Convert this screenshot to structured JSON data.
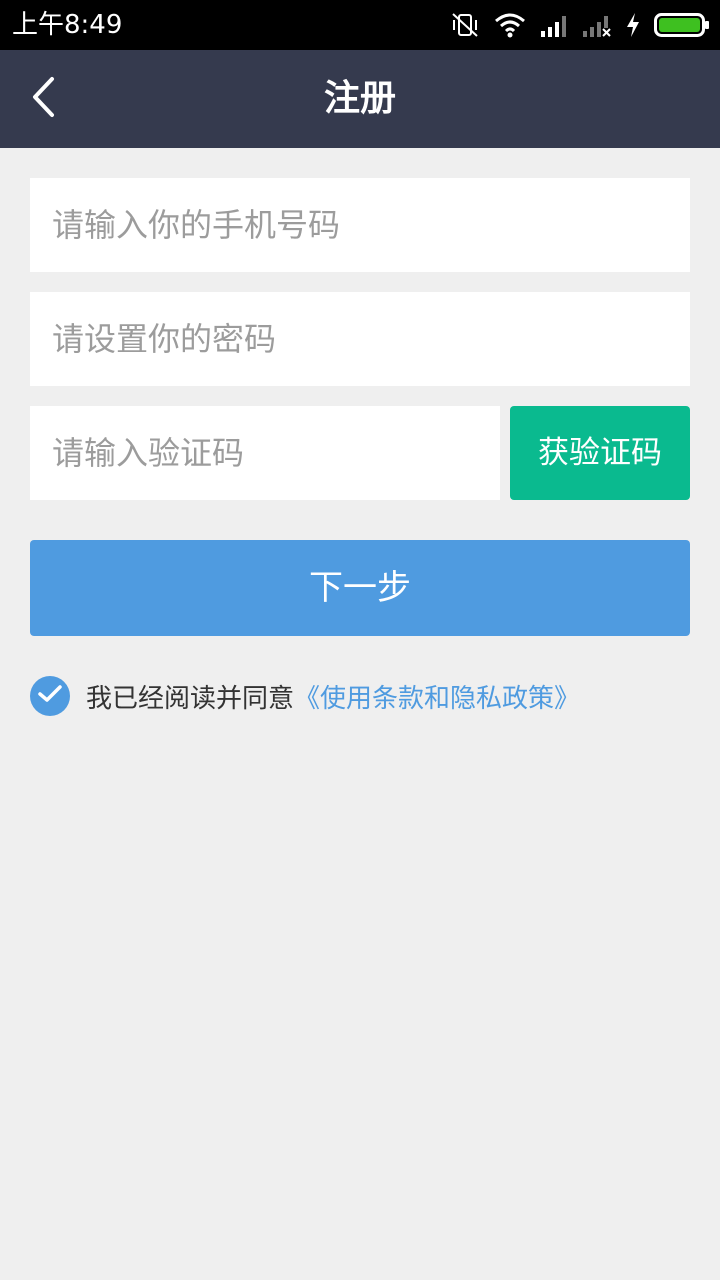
{
  "status_bar": {
    "time": "上午8:49"
  },
  "header": {
    "title": "注册"
  },
  "form": {
    "phone_placeholder": "请输入你的手机号码",
    "password_placeholder": "请设置你的密码",
    "code_placeholder": "请输入验证码",
    "get_code_label": "获验证码",
    "next_label": "下一步"
  },
  "agreement": {
    "checked": true,
    "text": "我已经阅读并同意",
    "link_text": "《使用条款和隐私政策》"
  },
  "colors": {
    "header_bg": "#353a4e",
    "page_bg": "#efefef",
    "primary_blue": "#4f9be0",
    "green_button": "#0aba8f",
    "battery_green": "#3ec020"
  },
  "icons": {
    "back": "chevron-left-icon",
    "mute": "vibrate-off-icon",
    "wifi": "wifi-icon",
    "signal_1": "signal-icon",
    "signal_2": "signal-off-icon",
    "charging": "bolt-icon",
    "battery": "battery-icon",
    "check": "check-icon"
  }
}
